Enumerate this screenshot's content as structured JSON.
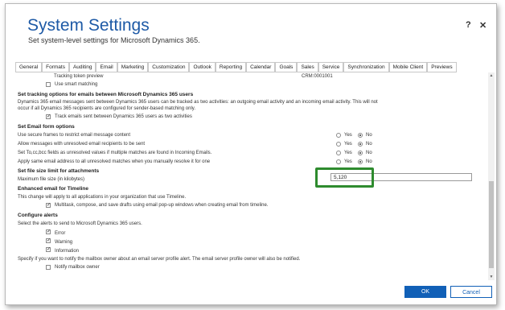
{
  "dialog": {
    "title": "System Settings",
    "subtitle": "Set system-level settings for Microsoft Dynamics 365.",
    "help_label": "?",
    "close_label": "✕"
  },
  "tabs": [
    "General",
    "Formats",
    "Auditing",
    "Email",
    "Marketing",
    "Customization",
    "Outlook",
    "Reporting",
    "Calendar",
    "Goals",
    "Sales",
    "Service",
    "Synchronization",
    "Mobile Client",
    "Previews"
  ],
  "top_rows": {
    "tracking_token_preview_label": "Tracking token preview",
    "tracking_token_preview_value": "CRM:0001001",
    "use_smart_matching_label": "Use smart matching"
  },
  "tracking_section": {
    "header": "Set tracking options for emails between Microsoft Dynamics 365 users",
    "description_line1": "Dynamics 365 email messages sent between Dynamics 365 users can be tracked as two activities: an outgoing email activity and an incoming email activity. This will not",
    "description_line2": "occur if all Dynamics 365 recipients are configured for sender-based matching only.",
    "checkbox_label": "Track emails sent between Dynamics 365 users as two activities",
    "checkbox_checked": true
  },
  "form_section": {
    "header": "Set Email form options",
    "yes_label": "Yes",
    "no_label": "No",
    "rows": [
      {
        "label": "Use secure frames to restrict email message content",
        "value": "No"
      },
      {
        "label": "Allow messages with unresolved email recipients to be sent",
        "value": "No"
      },
      {
        "label": "Set To,cc,bcc fields as unresolved values if multiple matches are found in Incoming Emails.",
        "value": "No"
      },
      {
        "label": "Apply same email address to all unresolved matches when you manually resolve it for one",
        "value": "No"
      }
    ]
  },
  "file_size_section": {
    "header": "Set file size limit for attachments",
    "field_label": "Maximum file size (in kilobytes)",
    "field_value": "5,120"
  },
  "timeline_section": {
    "header": "Enhanced email for Timeline",
    "description": "This change will apply to all applications in your organization that use Timeline.",
    "checkbox_label": "Multitask, compose, and save drafts using email pop-up windows when creating email from timeline.",
    "checkbox_checked": true
  },
  "alerts_section": {
    "header": "Configure alerts",
    "description": "Select the alerts to send to Microsoft Dynamics 365 users.",
    "items": [
      {
        "label": "Error",
        "checked": true
      },
      {
        "label": "Warning",
        "checked": true
      },
      {
        "label": "Information",
        "checked": true
      }
    ],
    "notify_description": "Specify if you want to notify the mailbox owner about an email server profile alert. The email server profile owner will also be notified.",
    "notify_label": "Notify mailbox owner",
    "notify_checked": false
  },
  "buttons": {
    "ok": "OK",
    "cancel": "Cancel"
  },
  "colors": {
    "title": "#1e5aa6",
    "primary_button": "#1160b7",
    "highlight": "#2e8b2e"
  }
}
